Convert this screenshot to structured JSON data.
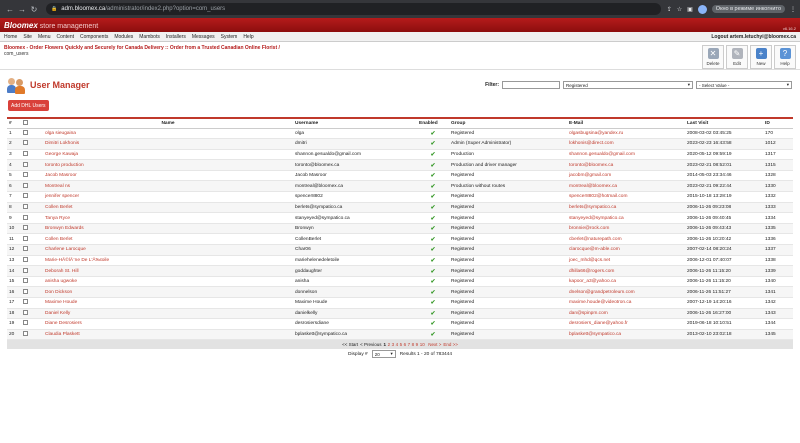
{
  "browser": {
    "url_host": "adm.bloomex.ca",
    "url_path": "/administrator/index2.php?option=com_users",
    "incognito_label": "Окно в режиме инкогнито"
  },
  "header": {
    "brand": "Bloomex",
    "brand_sub": "store management",
    "version": "v6.16.2",
    "menu": [
      "Home",
      "Site",
      "Menu",
      "Content",
      "Components",
      "Modules",
      "Mambots",
      "Installers",
      "Messages",
      "System",
      "Help"
    ],
    "logout_label": "Logout artem.letuchyi@bloomex.ca",
    "breadcrumb": "Bloomex - Order Flowers Quickly and Securely for Canada Delivery :: Order from a Trusted Canadian Online Florist /",
    "breadcrumb_sub": "com_users",
    "toolbar": {
      "delete": "Delete",
      "edit": "Edit",
      "new": "New",
      "help": "Help"
    }
  },
  "manager": {
    "title": "User Manager",
    "filter_label": "Filter:",
    "filter_value": "",
    "group_select": "Registered",
    "value_select": "- Select Value -",
    "add_button": "Add DHL Users"
  },
  "table": {
    "headers": {
      "num": "#",
      "name": "Name",
      "username": "Username",
      "enabled": "Enabled",
      "group": "Group",
      "email": "E-Mail",
      "lastvisit": "Last Visit",
      "id": "ID"
    },
    "rows": [
      {
        "num": "1",
        "name": "olga sieugaina",
        "username": "olga",
        "group": "Registered",
        "email": "olgasbugsina@yandex.ru",
        "lastvisit": "2008-03-02 03:45:25",
        "id": "170"
      },
      {
        "num": "2",
        "name": "Dimitri Lokhonis",
        "username": "dmitri",
        "group": "Admin (Super Administrator)",
        "email": "lokhonis@direct.com",
        "lastvisit": "2023-02-23 16:43:58",
        "id": "1012"
      },
      {
        "num": "3",
        "name": "George Kawaja",
        "username": "shannon.gesualdo@gmail.com",
        "group": "Production",
        "email": "shannon.gesualdo@gmail.com",
        "lastvisit": "2020-05-12 09:59:19",
        "id": "1317"
      },
      {
        "num": "4",
        "name": "toronto production",
        "username": "toronto@bloomex.ca",
        "group": "Production and driver manager",
        "email": "toronto@bloomex.ca",
        "lastvisit": "2023-02-21 08:52:01",
        "id": "1315"
      },
      {
        "num": "5",
        "name": "Jacob Masroor",
        "username": "Jacob Masroor",
        "group": "Registered",
        "email": "jacobm@gmail.com",
        "lastvisit": "2014-05-03 23:34:46",
        "id": "1328"
      },
      {
        "num": "6",
        "name": "Montreal ns",
        "username": "montreal@bloomex.ca",
        "group": "Production without routes",
        "email": "montreal@bloomex.ca",
        "lastvisit": "2023-02-21 09:22:44",
        "id": "1330"
      },
      {
        "num": "7",
        "name": "jennifer spencer",
        "username": "spencer8802",
        "group": "Registered",
        "email": "spencer8802@hotmail.com",
        "lastvisit": "2015-10-18 13:28:19",
        "id": "1332"
      },
      {
        "num": "8",
        "name": "Collen Berlet",
        "username": "berlets@sympatico.ca",
        "group": "Registered",
        "email": "berlets@sympatico.ca",
        "lastvisit": "2006-11-26 09:23:08",
        "id": "1333"
      },
      {
        "num": "9",
        "name": "Tanya Ryce",
        "username": "stanyeyed@sympatico.ca",
        "group": "Registered",
        "email": "stanyeyed@sympatico.ca",
        "lastvisit": "2006-11-26 09:40:45",
        "id": "1334"
      },
      {
        "num": "10",
        "name": "Bronwyn Edwards",
        "username": "Bronwyn",
        "group": "Registered",
        "email": "bronnie@rock.com",
        "lastvisit": "2006-11-26 09:43:43",
        "id": "1335"
      },
      {
        "num": "11",
        "name": "Collen Berlet",
        "username": "CollenBerlet",
        "group": "Registered",
        "email": "cberlet@naturepath.com",
        "lastvisit": "2006-11-26 10:20:42",
        "id": "1336"
      },
      {
        "num": "12",
        "name": "Charlene Larocque",
        "username": "Char06",
        "group": "Registered",
        "email": "clarocque@m-able.com",
        "lastvisit": "2007-02-14 08:20:24",
        "id": "1337"
      },
      {
        "num": "13",
        "name": "Marie-HÃ©lÃ¨ne De L'Ã‰toile",
        "username": "mariehelenedeletoile",
        "group": "Registered",
        "email": "joec_mhd@qcs.net",
        "lastvisit": "2006-12-01 07:40:07",
        "id": "1338"
      },
      {
        "num": "14",
        "name": "Deborah St. Hill",
        "username": "goddaughter",
        "group": "Registered",
        "email": "dhilla66@rogers.com",
        "lastvisit": "2006-11-26 11:15:20",
        "id": "1339"
      },
      {
        "num": "15",
        "name": "anisha ugwoke",
        "username": "anisha",
        "group": "Registered",
        "email": "kapoor_a3@yahoo.ca",
        "lastvisit": "2006-11-26 11:15:20",
        "id": "1340"
      },
      {
        "num": "16",
        "name": "Don Dickson",
        "username": "donnelson",
        "group": "Registered",
        "email": "dnelson@grandpetroleum.com",
        "lastvisit": "2006-11-26 11:51:27",
        "id": "1341"
      },
      {
        "num": "17",
        "name": "Maxime Houde",
        "username": "Maxime Houde",
        "group": "Registered",
        "email": "maxime.houde@videotron.ca",
        "lastvisit": "2007-12-19 14:20:16",
        "id": "1342"
      },
      {
        "num": "18",
        "name": "Daniel Kelly",
        "username": "danielkelly",
        "group": "Registered",
        "email": "dan@spinpm.com",
        "lastvisit": "2006-11-26 16:27:00",
        "id": "1343"
      },
      {
        "num": "19",
        "name": "Diane Desrosiers",
        "username": "desrosiersdiane",
        "group": "Registered",
        "email": "desrosiers_diane@yahoo.fr",
        "lastvisit": "2019-06-18 10:10:51",
        "id": "1344"
      },
      {
        "num": "20",
        "name": "Claudia Plaskett",
        "username": "bplaskett@sympatico.ca",
        "group": "Registered",
        "email": "bplaskett@sympatico.ca",
        "lastvisit": "2013-02-10 23:02:18",
        "id": "1345"
      }
    ]
  },
  "pager": {
    "start": "<< Start",
    "prev": "< Previous",
    "pages": [
      "1",
      "2",
      "3",
      "4",
      "5",
      "6",
      "7",
      "8",
      "9",
      "10"
    ],
    "next": "Next >",
    "end": "End >>",
    "display_label": "Display #",
    "display_value": "20",
    "results": "Results 1 - 20 of 783444"
  },
  "colors": {
    "accent": "#c0392b",
    "brand_bar": "#b51b1b",
    "enabled_tick": "#3a9a2c"
  }
}
